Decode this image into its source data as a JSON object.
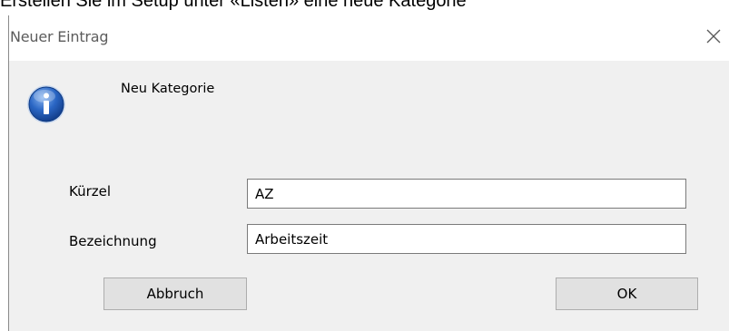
{
  "doc": {
    "heading": "Erstellen Sie im Setup unter «Listen» eine neue Kategorie"
  },
  "dialog": {
    "title": "Neuer Eintrag",
    "close_symbol": "×",
    "icon": "info-icon",
    "message": "Neu Kategorie",
    "fields": {
      "kuerzel": {
        "label": "Kürzel",
        "value": "AZ"
      },
      "bezeichnung": {
        "label": "Bezeichnung",
        "value": "Arbeitszeit"
      }
    },
    "buttons": {
      "cancel": "Abbruch",
      "ok": "OK"
    }
  },
  "colors": {
    "icon_blue": "#1f5fbf",
    "dialog_bg": "#f0f0f0",
    "button_bg": "#e1e1e1"
  }
}
